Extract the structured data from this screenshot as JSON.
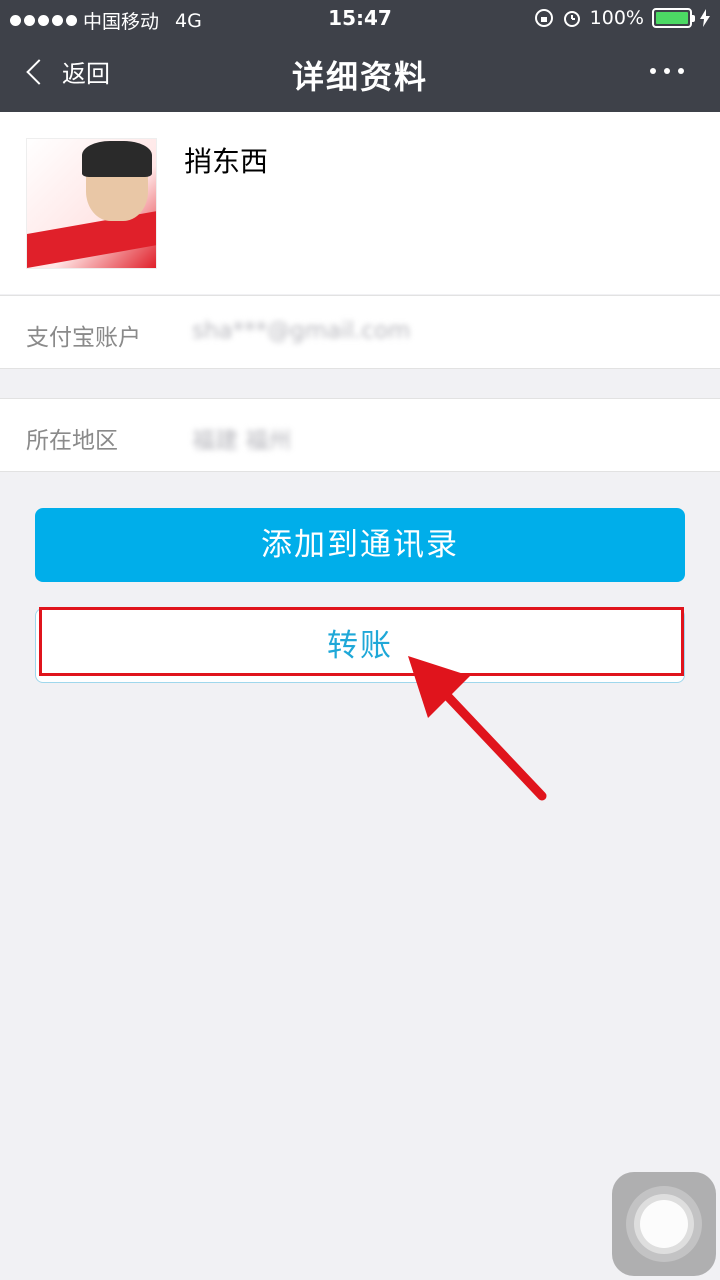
{
  "status_bar": {
    "carrier": "中国移动",
    "network": "4G",
    "time": "15:47",
    "battery": "100%",
    "battery_color": "#4cd964"
  },
  "navbar": {
    "back_label": "返回",
    "title": "详细资料",
    "more_icon": "more-dots-icon"
  },
  "profile": {
    "name": "捎东西"
  },
  "details": {
    "account_label": "支付宝账户",
    "account_value": "sha***@gmail.com",
    "region_label": "所在地区",
    "region_value": "福建 福州"
  },
  "actions": {
    "add_contact": "添加到通讯录",
    "transfer": "转账"
  },
  "colors": {
    "header": "#3e4149",
    "primary_button": "#00aeea",
    "transfer_text": "#1fa8d8",
    "highlight": "#e0141c",
    "background": "#f1f1f4"
  },
  "annotation_icon": "red-arrow-icon",
  "assistive_touch_icon": "assistive-touch-icon"
}
